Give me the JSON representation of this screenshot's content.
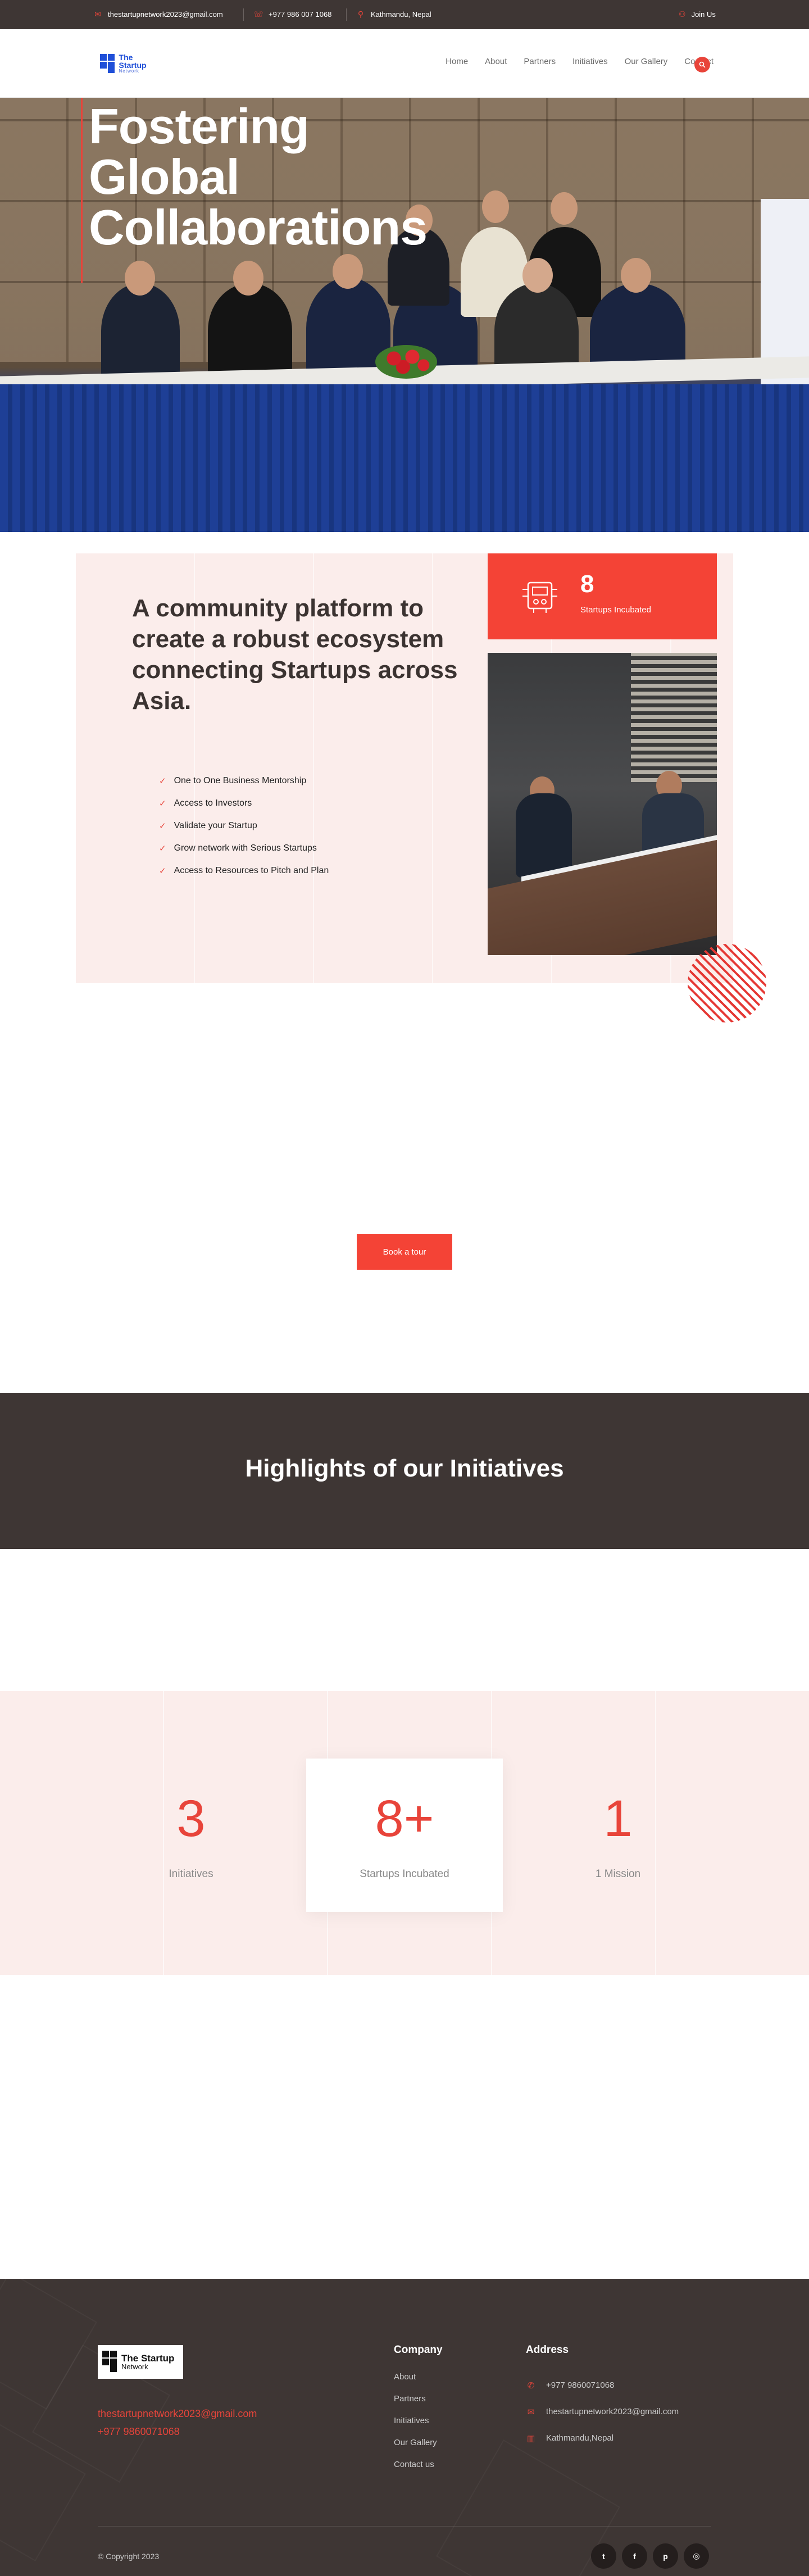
{
  "topbar": {
    "email": "thestartupnetwork2023@gmail.com",
    "phone": "+977 986 007 1068",
    "location": "Kathmandu, Nepal",
    "join": "Join Us"
  },
  "header": {
    "logo_name": "The Startup",
    "logo_sub": "Network",
    "nav": [
      "Home",
      "About",
      "Partners",
      "Initiatives",
      "Our Gallery",
      "Contact"
    ]
  },
  "hero": {
    "title_lines": [
      "Fostering",
      "Global",
      "Collaborations"
    ]
  },
  "about": {
    "title": "A community platform to create a robust ecosystem connecting Startups across Asia.",
    "checklist": [
      "One to One Business Mentorship",
      "Access to Investors",
      "Validate your Startup",
      "Grow network with Serious Startups",
      "Access to Resources to Pitch and Plan"
    ],
    "stat_number": "8",
    "stat_label": "Startups Incubated"
  },
  "cta": {
    "tour_label": "Book a tour"
  },
  "highlights": {
    "title": "Highlights of our Initiatives"
  },
  "counters": [
    {
      "value": "3",
      "label": "Initiatives"
    },
    {
      "value": "8+",
      "label": "Startups Incubated"
    },
    {
      "value": "1",
      "label": "1 Mission"
    }
  ],
  "footer": {
    "logo_name": "The Startup",
    "logo_sub": "Network",
    "email": "thestartupnetwork2023@gmail.com",
    "phone": "+977 9860071068",
    "company_title": "Company",
    "company_links": [
      "About",
      "Partners",
      "Initiatives",
      "Our Gallery",
      "Contact us"
    ],
    "address_title": "Address",
    "address": {
      "phone": "+977 9860071068",
      "email": "thestartupnetwork2023@gmail.com",
      "location": "Kathmandu,Nepal"
    },
    "copyright": "© Copyright 2023",
    "socials": [
      "twitter-icon",
      "facebook-icon",
      "pinterest-icon",
      "instagram-icon"
    ]
  },
  "colors": {
    "accent": "#f44336",
    "dark": "#3e3634",
    "tint": "#fbedeb"
  }
}
